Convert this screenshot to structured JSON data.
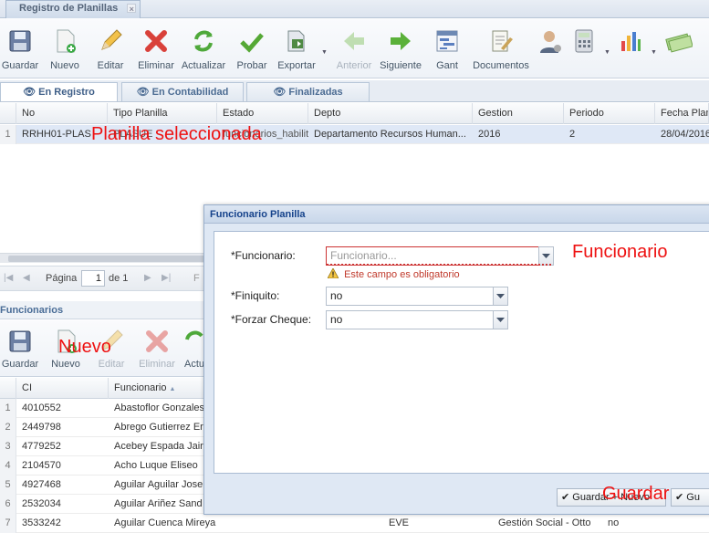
{
  "window": {
    "tab_title": "Registro de Planillas",
    "close_glyph": "×"
  },
  "toolbar": {
    "buttons": [
      {
        "label": "Guardar",
        "icon": "floppy-icon",
        "enabled": true
      },
      {
        "label": "Nuevo",
        "icon": "new-doc-icon",
        "enabled": true
      },
      {
        "label": "Editar",
        "icon": "pencil-icon",
        "enabled": true
      },
      {
        "label": "Eliminar",
        "icon": "delete-x-icon",
        "enabled": true
      },
      {
        "label": "Actualizar",
        "icon": "refresh-icon",
        "enabled": true
      },
      {
        "label": "Probar",
        "icon": "checkmark-icon",
        "enabled": true
      },
      {
        "label": "Exportar",
        "icon": "export-icon",
        "enabled": true
      },
      {
        "label": "Anterior",
        "icon": "arrow-left-icon",
        "enabled": false
      },
      {
        "label": "Siguiente",
        "icon": "arrow-right-icon",
        "enabled": true
      },
      {
        "label": "Gant",
        "icon": "gantt-icon",
        "enabled": true
      },
      {
        "label": "Documentos",
        "icon": "documents-icon",
        "enabled": true
      }
    ],
    "extra_icons": [
      "user-icon",
      "calculator-icon",
      "bar-chart-icon",
      "money-icon"
    ]
  },
  "status_tabs": [
    {
      "label": "En Registro",
      "active": true
    },
    {
      "label": "En Contabilidad",
      "active": false
    },
    {
      "label": "Finalizadas",
      "active": false
    }
  ],
  "planillas_grid": {
    "columns": [
      "No",
      "Tipo Planilla",
      "Estado",
      "Depto",
      "Gestion",
      "Periodo",
      "Fecha Plan"
    ],
    "rows": [
      {
        "rownum": "1",
        "no": "RRHH01-PLAS",
        "tipo": "PLASUE",
        "estado": "funcionarios_habilitado",
        "depto": "Departamento Recursos Human...",
        "gestion": "2016",
        "periodo": "2",
        "fecha": "28/04/2016"
      }
    ]
  },
  "pager": {
    "page_label": "Página",
    "page_value": "1",
    "of_label": "de 1",
    "filter_glyph": "F"
  },
  "funcionarios_panel": {
    "title": "Funcionarios",
    "toolbar": [
      {
        "label": "Guardar",
        "icon": "floppy-icon",
        "enabled": true
      },
      {
        "label": "Nuevo",
        "icon": "new-doc-icon",
        "enabled": true
      },
      {
        "label": "Editar",
        "icon": "pencil-icon",
        "enabled": false
      },
      {
        "label": "Eliminar",
        "icon": "delete-x-icon",
        "enabled": false
      },
      {
        "label": "Actu",
        "icon": "refresh-icon",
        "enabled": true
      }
    ],
    "columns": [
      "CI",
      "Funcionario"
    ],
    "rows": [
      {
        "rownum": "1",
        "ci": "4010552",
        "funcionario": "Abastoflor Gonzales"
      },
      {
        "rownum": "2",
        "ci": "2449798",
        "funcionario": "Abrego Gutierrez Er"
      },
      {
        "rownum": "3",
        "ci": "4779252",
        "funcionario": "Acebey Espada Jair"
      },
      {
        "rownum": "4",
        "ci": "2104570",
        "funcionario": "Acho Luque Eliseo"
      },
      {
        "rownum": "5",
        "ci": "4927468",
        "funcionario": "Aguilar Aguilar Jose"
      },
      {
        "rownum": "6",
        "ci": "2532034",
        "funcionario": "Aguilar Ariñez Sand"
      },
      {
        "rownum": "7",
        "ci": "3533242",
        "funcionario": "Aguilar Cuenca Mireya",
        "extra1": "EVE",
        "extra2": "Gestión Social - Otto",
        "extra3": "no"
      }
    ]
  },
  "modal": {
    "title": "Funcionario Planilla",
    "fields": [
      {
        "label": "*Funcionario:",
        "value": "",
        "placeholder": "Funcionario...",
        "invalid": true,
        "error": "Este campo es obligatorio"
      },
      {
        "label": "*Finiquito:",
        "value": "no"
      },
      {
        "label": "*Forzar Cheque:",
        "value": "no"
      }
    ],
    "buttons": [
      {
        "label": "Guardar + Nuevo"
      },
      {
        "label": "Gu"
      }
    ]
  },
  "annotations": {
    "planilla": "Planilla seleccionada",
    "funcionario": "Funcionario",
    "nuevo": "Nuevo",
    "guardar": "Guardar"
  },
  "colors": {
    "annotation": "#ee1111",
    "accent": "#15428b",
    "error": "#c0392b"
  }
}
